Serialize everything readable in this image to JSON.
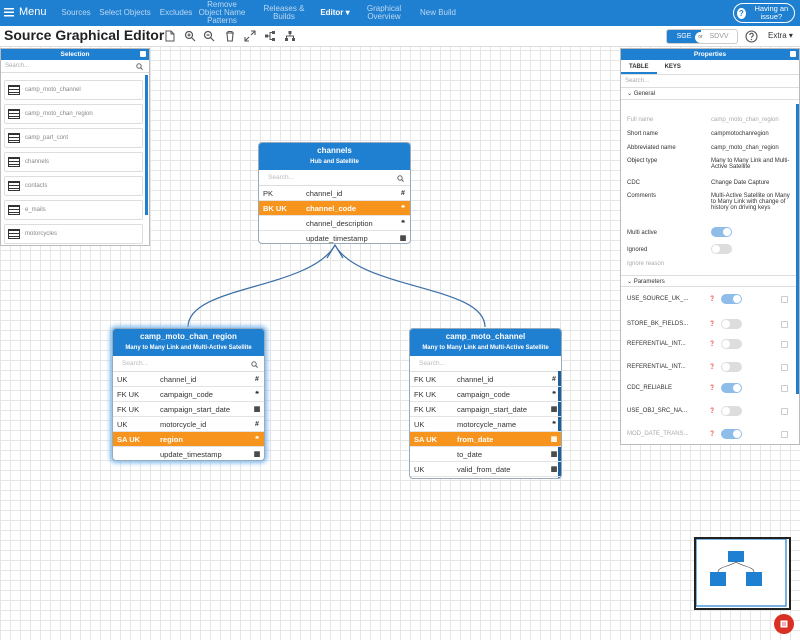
{
  "topbar": {
    "menu_label": "Menu",
    "nav": [
      {
        "label": "Sources"
      },
      {
        "label": "Select Objects"
      },
      {
        "label": "Excludes"
      },
      {
        "label": "Remove Object Name Patterns"
      },
      {
        "label": "Releases & Builds"
      },
      {
        "label": "Editor ▾"
      },
      {
        "label": "Graphical Overview"
      },
      {
        "label": "New Build"
      }
    ],
    "issue_label": "Having an issue?"
  },
  "toolbar": {
    "title": "Source Graphical Editor",
    "seg_a": "SGE",
    "seg_or": "or",
    "seg_b": "SDVV",
    "extra": "Extra ▾"
  },
  "selection": {
    "title": "Selection",
    "search_placeholder": "Search...",
    "items": [
      "camp_moto_channel",
      "camp_moto_chan_region",
      "camp_part_cont",
      "channels",
      "contacts",
      "e_mails",
      "motorcycles"
    ]
  },
  "entities": {
    "channels": {
      "name": "channels",
      "subtitle": "Hub and Satellite",
      "search_placeholder": "Search...",
      "rows": [
        {
          "key": "PK",
          "col": "channel_id",
          "icon": "#"
        },
        {
          "key": "BK  UK",
          "col": "channel_code",
          "icon": "❝"
        },
        {
          "key": "",
          "col": "channel_description",
          "icon": "❝"
        },
        {
          "key": "",
          "col": "update_timestamp",
          "icon": "▦"
        }
      ]
    },
    "region": {
      "name": "camp_moto_chan_region",
      "subtitle": "Many to Many Link and Multi-Active Satellite",
      "search_placeholder": "Search...",
      "rows": [
        {
          "key": "UK",
          "col": "channel_id",
          "icon": "#"
        },
        {
          "key": "FK UK",
          "col": "campaign_code",
          "icon": "❝"
        },
        {
          "key": "FK UK",
          "col": "campaign_start_date",
          "icon": "▦"
        },
        {
          "key": "UK",
          "col": "motorcycle_id",
          "icon": "#"
        },
        {
          "key": "SA UK",
          "col": "region",
          "icon": "❝"
        },
        {
          "key": "",
          "col": "update_timestamp",
          "icon": "▦"
        }
      ]
    },
    "channel": {
      "name": "camp_moto_channel",
      "subtitle": "Many to Many Link and Multi-Active Satellite",
      "search_placeholder": "Search...",
      "rows": [
        {
          "key": "FK UK",
          "col": "channel_id",
          "icon": "#"
        },
        {
          "key": "FK UK",
          "col": "campaign_code",
          "icon": "❝"
        },
        {
          "key": "FK UK",
          "col": "campaign_start_date",
          "icon": "▦"
        },
        {
          "key": "UK",
          "col": "motorcycle_name",
          "icon": "❝"
        },
        {
          "key": "SA UK",
          "col": "from_date",
          "icon": "▦"
        },
        {
          "key": "",
          "col": "to_date",
          "icon": "▦"
        },
        {
          "key": "UK",
          "col": "valid_from_date",
          "icon": "▦"
        }
      ]
    }
  },
  "properties": {
    "title": "Properties",
    "tab_table": "TABLE",
    "tab_keys": "KEYS",
    "search_placeholder": "Search...",
    "general_label": "General",
    "fields": [
      {
        "k": "Full name",
        "v": "camp_moto_chan_region"
      },
      {
        "k": "Short name",
        "v": "campmotochanregion"
      },
      {
        "k": "Abbreviated name",
        "v": "camp_moto_chan_region"
      },
      {
        "k": "Object type",
        "v": "Many to Many Link and Multi-Active Satellite"
      },
      {
        "k": "CDC",
        "v": "Change Date Capture"
      },
      {
        "k": "Comments",
        "v": "Multi-Active Satellite on Many to Many Link with change of history on driving keys"
      }
    ],
    "multi_active": "Multi active",
    "ignored": "Ignored",
    "ignore_reason": "Ignore reason",
    "parameters_label": "Parameters",
    "params": [
      {
        "name": "USE_SOURCE_UK_...",
        "on": true
      },
      {
        "name": "STORE_BK_FIELDS...",
        "on": false
      },
      {
        "name": "REFERENTIAL_INT...",
        "on": false
      },
      {
        "name": "REFERENTIAL_INT...",
        "on": false
      },
      {
        "name": "CDC_RELIABLE",
        "on": true
      },
      {
        "name": "USE_OBJ_SRC_NA...",
        "on": false
      },
      {
        "name": "MOD_DATE_TRANS...",
        "on": true
      }
    ]
  },
  "colors": {
    "primary": "#1f7fd0",
    "highlight": "#f7941d",
    "fab": "#d93025"
  }
}
